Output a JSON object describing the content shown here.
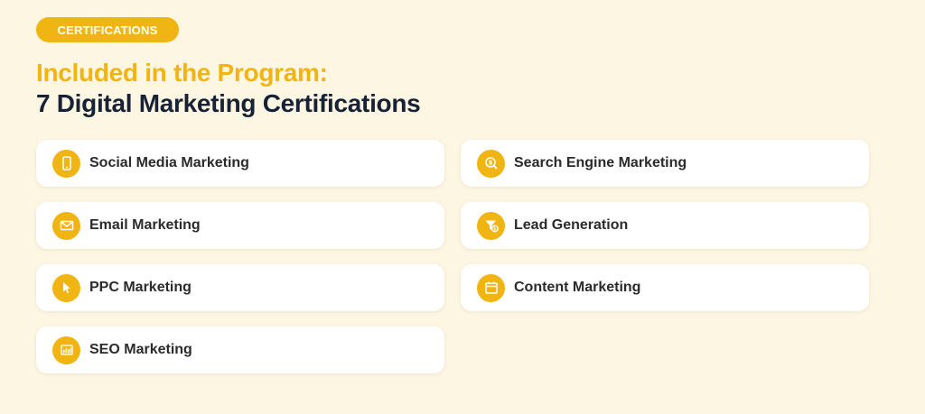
{
  "badge": {
    "label": "CERTIFICATIONS"
  },
  "heading": {
    "line1": "Included in the Program:",
    "line2": "7 Digital Marketing Certifications"
  },
  "colors": {
    "accent": "#f0b512",
    "heading_dark": "#172237",
    "background": "#fdf6e3",
    "card": "#ffffff"
  },
  "certifications": [
    {
      "label": "Social Media Marketing",
      "icon": "smartphone-icon"
    },
    {
      "label": "Search Engine Marketing",
      "icon": "dollar-search-icon"
    },
    {
      "label": "Email Marketing",
      "icon": "envelope-icon"
    },
    {
      "label": "Lead Generation",
      "icon": "funnel-dollar-icon"
    },
    {
      "label": "PPC Marketing",
      "icon": "cursor-pointer-icon"
    },
    {
      "label": "Content Marketing",
      "icon": "calendar-icon"
    },
    {
      "label": "SEO Marketing",
      "icon": "bar-chart-icon"
    }
  ]
}
